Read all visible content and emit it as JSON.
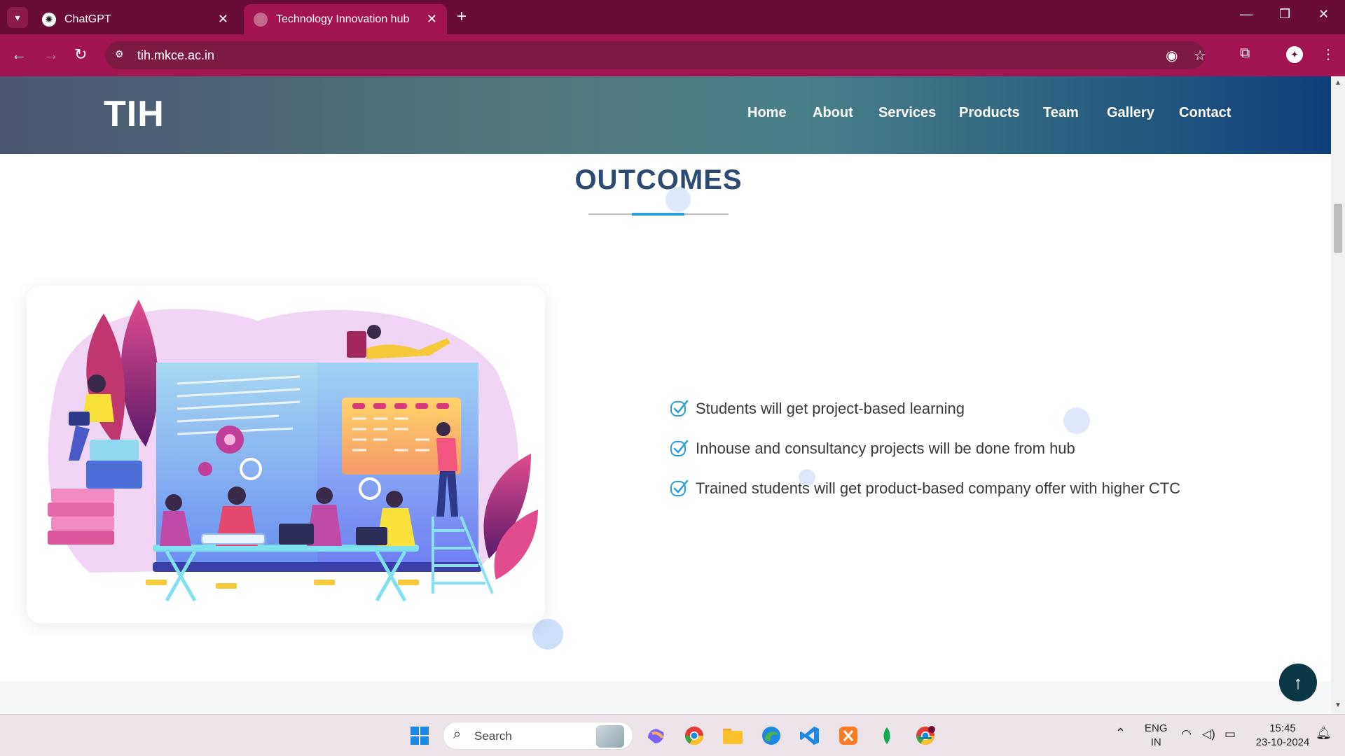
{
  "browser": {
    "tabs": [
      {
        "title": "ChatGPT",
        "active": false
      },
      {
        "title": "Technology Innovation hub",
        "active": true
      }
    ],
    "url": "tih.mkce.ac.in"
  },
  "site": {
    "logo": "TIH",
    "nav": [
      "Home",
      "About",
      "Services",
      "Products",
      "Team",
      "Gallery",
      "Contact"
    ]
  },
  "section": {
    "title": "OUTCOMES",
    "items": [
      "Students will get project-based learning",
      "Inhouse and consultancy projects will be done from hub",
      "Trained students will get product-based company offer with higher CTC"
    ]
  },
  "taskbar": {
    "search_label": "Search",
    "language": "ENG",
    "region": "IN",
    "time": "15:45",
    "date": "23-10-2024"
  },
  "colors": {
    "browser_frame": "#6a0d36",
    "browser_toolbar": "#a1144f",
    "title_color": "#2d4a73",
    "accent": "#2a9ed8",
    "to_top_button": "#0b3845"
  }
}
